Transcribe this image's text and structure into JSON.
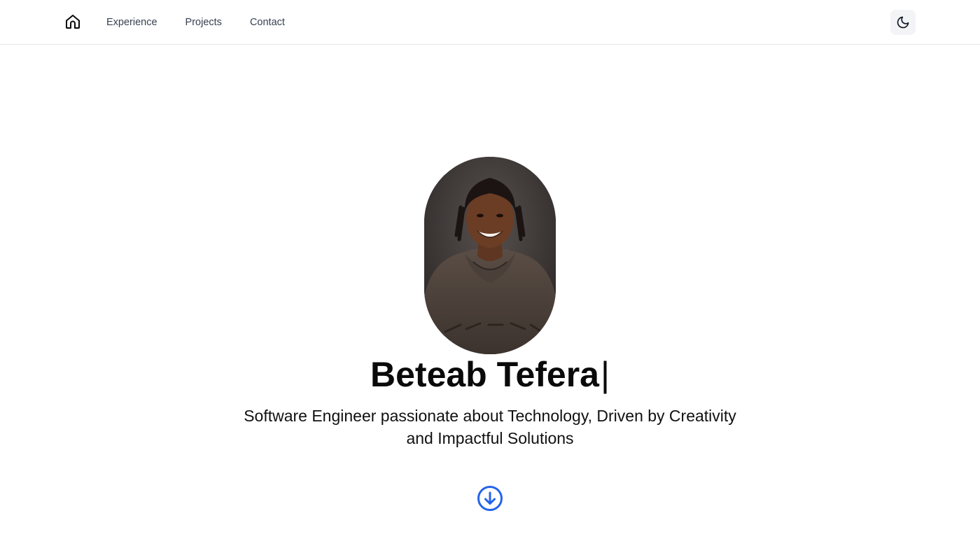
{
  "nav": {
    "home_icon": "house-icon",
    "links": [
      {
        "label": "Experience"
      },
      {
        "label": "Projects"
      },
      {
        "label": "Contact"
      }
    ],
    "theme_icon": "moon-icon"
  },
  "hero": {
    "name": "Beteab Tefera",
    "caret": "|",
    "tagline_line1": "Software Engineer passionate about Technology, Driven by Creativity",
    "tagline_line2": "and Impactful Solutions",
    "scroll_icon": "arrow-down-circle-icon"
  },
  "colors": {
    "accent": "#2563eb",
    "nav_text": "#374151",
    "border": "#e5e7eb",
    "toggle_bg": "#f3f4f6"
  }
}
